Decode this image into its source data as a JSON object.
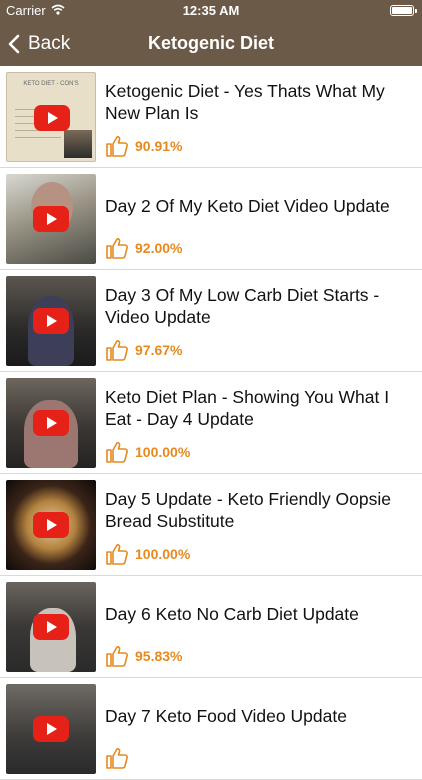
{
  "status_bar": {
    "carrier": "Carrier",
    "time": "12:35 AM"
  },
  "nav": {
    "back_label": "Back",
    "title": "Ketogenic Diet"
  },
  "colors": {
    "nav_bg": "#6b5a48",
    "accent": "#e6891f",
    "play": "#e62117"
  },
  "videos": [
    {
      "title": "Ketogenic Diet - Yes Thats What My New Plan Is",
      "rating": "90.91%",
      "slide_title": "KETO DIET - CON'S"
    },
    {
      "title": "Day 2 Of My Keto Diet Video Update",
      "rating": "92.00%"
    },
    {
      "title": "Day 3 Of My Low Carb Diet Starts - Video Update",
      "rating": "97.67%"
    },
    {
      "title": "Keto Diet Plan - Showing You What I Eat - Day 4 Update",
      "rating": "100.00%"
    },
    {
      "title": "Day 5 Update - Keto Friendly Oopsie Bread Substitute",
      "rating": "100.00%"
    },
    {
      "title": "Day 6 Keto No Carb Diet Update",
      "rating": "95.83%"
    },
    {
      "title": "Day 7 Keto Food Video Update",
      "rating": ""
    }
  ]
}
